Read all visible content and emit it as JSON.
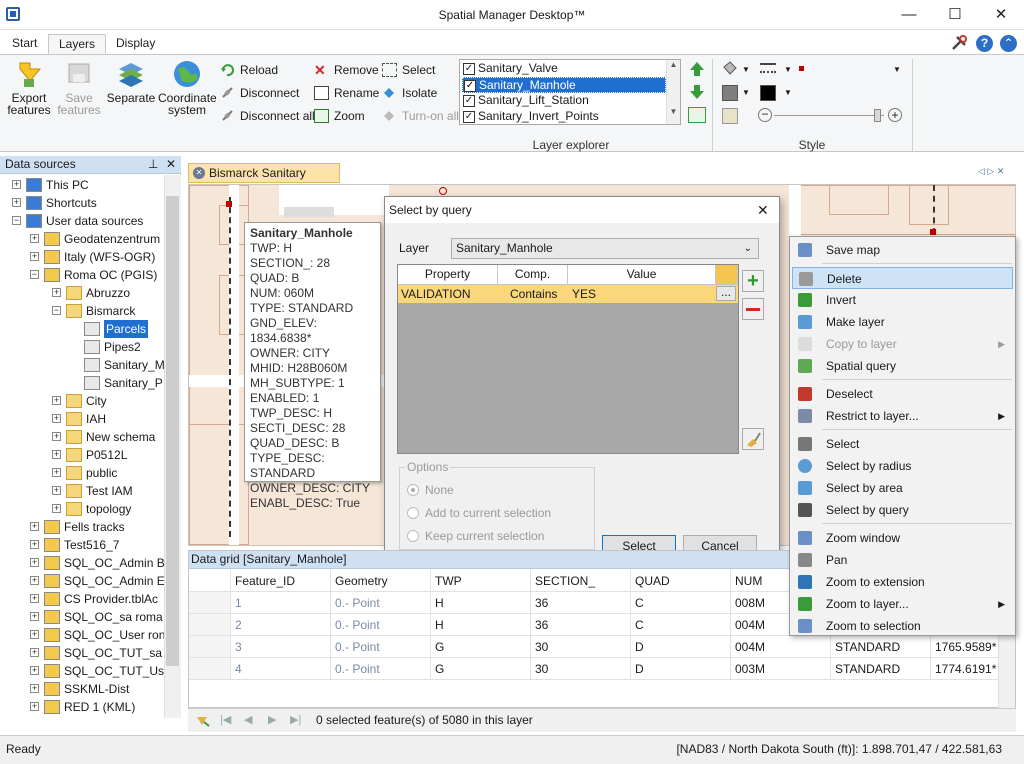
{
  "app": {
    "title": "Spatial Manager Desktop™"
  },
  "window_controls": {
    "minimize": "—",
    "maximize": "☐",
    "close": "✕"
  },
  "ribbon_tabs": [
    {
      "label": "Start"
    },
    {
      "label": "Layers"
    },
    {
      "label": "Display"
    }
  ],
  "ribbon": {
    "export_features": "Export\nfeatures",
    "save_features": "Save\nfeatures",
    "separate": "Separate",
    "coordinate_system": "Coordinate\nsystem",
    "reload": "Reload",
    "disconnect": "Disconnect",
    "disconnect_all": "Disconnect all",
    "remove": "Remove",
    "rename": "Rename",
    "zoom": "Zoom",
    "select": "Select",
    "isolate": "Isolate",
    "turn_on_all": "Turn-on all",
    "layer_explorer_label": "Layer explorer",
    "style_label": "Style",
    "layers": [
      {
        "label": "Sanitary_Valve",
        "checked": true,
        "selected": false
      },
      {
        "label": "Sanitary_Manhole",
        "checked": true,
        "selected": true
      },
      {
        "label": "Sanitary_Lift_Station",
        "checked": true,
        "selected": false
      },
      {
        "label": "Sanitary_Invert_Points",
        "checked": true,
        "selected": false
      }
    ],
    "colors": {
      "fill": "#7f7f7f",
      "stroke": "#000000",
      "accent": "#c00000"
    }
  },
  "datasources": {
    "title": "Data sources",
    "items": [
      {
        "label": "This PC",
        "level": 0,
        "exp": "+"
      },
      {
        "label": "Shortcuts",
        "level": 0,
        "exp": "+"
      },
      {
        "label": "User data sources",
        "level": 0,
        "exp": "−"
      },
      {
        "label": "Geodatenzentrum",
        "level": 1,
        "exp": "+"
      },
      {
        "label": "Italy (WFS-OGR)",
        "level": 1,
        "exp": "+"
      },
      {
        "label": "Roma OC (PGIS)",
        "level": 1,
        "exp": "−"
      },
      {
        "label": "Abruzzo",
        "level": 2,
        "exp": "+"
      },
      {
        "label": "Bismarck",
        "level": 2,
        "exp": "−"
      },
      {
        "label": "Parcels",
        "level": 3,
        "exp": "",
        "selected": true
      },
      {
        "label": "Pipes2",
        "level": 3,
        "exp": ""
      },
      {
        "label": "Sanitary_M",
        "level": 3,
        "exp": ""
      },
      {
        "label": "Sanitary_P",
        "level": 3,
        "exp": ""
      },
      {
        "label": "City",
        "level": 2,
        "exp": "+"
      },
      {
        "label": "IAH",
        "level": 2,
        "exp": "+"
      },
      {
        "label": "New schema",
        "level": 2,
        "exp": "+"
      },
      {
        "label": "P0512L",
        "level": 2,
        "exp": "+"
      },
      {
        "label": "public",
        "level": 2,
        "exp": "+"
      },
      {
        "label": "Test IAM",
        "level": 2,
        "exp": "+"
      },
      {
        "label": "topology",
        "level": 2,
        "exp": "+"
      },
      {
        "label": "Fells tracks",
        "level": 1,
        "exp": "+"
      },
      {
        "label": "Test516_7",
        "level": 1,
        "exp": "+"
      },
      {
        "label": "SQL_OC_Admin B",
        "level": 1,
        "exp": "+"
      },
      {
        "label": "SQL_OC_Admin E",
        "level": 1,
        "exp": "+"
      },
      {
        "label": "CS Provider.tblAc",
        "level": 1,
        "exp": "+"
      },
      {
        "label": "SQL_OC_sa roma",
        "level": 1,
        "exp": "+"
      },
      {
        "label": "SQL_OC_User ron",
        "level": 1,
        "exp": "+"
      },
      {
        "label": "SQL_OC_TUT_sa r",
        "level": 1,
        "exp": "+"
      },
      {
        "label": "SQL_OC_TUT_Use",
        "level": 1,
        "exp": "+"
      },
      {
        "label": "SSKML-Dist",
        "level": 1,
        "exp": "+"
      },
      {
        "label": "RED 1 (KML)",
        "level": 1,
        "exp": "+"
      }
    ]
  },
  "doc_tab": {
    "label": "Bismarck Sanitary sewer *"
  },
  "infobox": {
    "title": "Sanitary_Manhole",
    "lines": [
      "TWP: H",
      "SECTION_: 28",
      "QUAD: B",
      "NUM: 060M",
      "TYPE: STANDARD",
      "GND_ELEV: 1834.6838*",
      "OWNER: CITY",
      "MHID: H28B060M",
      "MH_SUBTYPE: 1",
      "ENABLED: 1",
      "TWP_DESC: H",
      "SECTI_DESC: 28",
      "QUAD_DESC: B",
      "TYPE_DESC: STANDARD",
      "OWNER_DESC: CITY",
      "ENABL_DESC: True"
    ]
  },
  "dialog": {
    "title": "Select by query",
    "layer_label": "Layer",
    "layer_value": "Sanitary_Manhole",
    "col_property": "Property",
    "col_comp": "Comp.",
    "col_value": "Value",
    "row": {
      "property": "VALIDATION",
      "comp": "Contains",
      "value": "YES",
      "browse": "..."
    },
    "options_label": "Options",
    "opt_none": "None",
    "opt_add": "Add to current selection",
    "opt_keep": "Keep current selection",
    "select_btn": "Select",
    "cancel_btn": "Cancel"
  },
  "datagrid": {
    "title": "Data grid [Sanitary_Manhole]",
    "columns": [
      "Feature_ID",
      "Geometry",
      "TWP",
      "SECTION_",
      "QUAD",
      "NUM"
    ],
    "rows": [
      {
        "Feature_ID": "1",
        "Geometry": "0.- Point",
        "TWP": "H",
        "SECTION_": "36",
        "QUAD": "C",
        "NUM": "008M",
        "TYPE": "",
        "GND": ""
      },
      {
        "Feature_ID": "2",
        "Geometry": "0.- Point",
        "TWP": "H",
        "SECTION_": "36",
        "QUAD": "C",
        "NUM": "004M",
        "TYPE": "",
        "GND": ""
      },
      {
        "Feature_ID": "3",
        "Geometry": "0.- Point",
        "TWP": "G",
        "SECTION_": "30",
        "QUAD": "D",
        "NUM": "004M",
        "TYPE": "STANDARD",
        "GND": "1765.9589*"
      },
      {
        "Feature_ID": "4",
        "Geometry": "0.- Point",
        "TWP": "G",
        "SECTION_": "30",
        "QUAD": "D",
        "NUM": "003M",
        "TYPE": "STANDARD",
        "GND": "1774.6191*"
      }
    ],
    "status": "0 selected feature(s) of 5080 in this layer"
  },
  "statusbar": {
    "left": "Ready",
    "right": "[NAD83 / North Dakota South (ft)]: 1.898.701,47 / 422.581,63"
  },
  "context_menu": {
    "items": [
      {
        "label": "Save map",
        "icon": "save-map-icon",
        "highlighted": false,
        "disabled": false,
        "submenu": false
      },
      {
        "label": "Delete",
        "icon": "eraser-icon",
        "highlighted": true,
        "disabled": false,
        "submenu": false
      },
      {
        "label": "Invert",
        "icon": "invert-icon",
        "highlighted": false,
        "disabled": false,
        "submenu": false
      },
      {
        "label": "Make layer",
        "icon": "make-layer-icon",
        "highlighted": false,
        "disabled": false,
        "submenu": false
      },
      {
        "label": "Copy to layer",
        "icon": "copy-to-layer-icon",
        "highlighted": false,
        "disabled": true,
        "submenu": true
      },
      {
        "label": "Spatial query",
        "icon": "spatial-query-icon",
        "highlighted": false,
        "disabled": false,
        "submenu": false
      },
      {
        "label": "Deselect",
        "icon": "deselect-icon",
        "highlighted": false,
        "disabled": false,
        "submenu": false
      },
      {
        "label": "Restrict to layer...",
        "icon": "restrict-icon",
        "highlighted": false,
        "disabled": false,
        "submenu": true
      },
      {
        "label": "Select",
        "icon": "pointer-icon",
        "highlighted": false,
        "disabled": false,
        "submenu": false
      },
      {
        "label": "Select by radius",
        "icon": "circle-icon",
        "highlighted": false,
        "disabled": false,
        "submenu": false
      },
      {
        "label": "Select by area",
        "icon": "polygon-icon",
        "highlighted": false,
        "disabled": false,
        "submenu": false
      },
      {
        "label": "Select by query",
        "icon": "binoculars-icon",
        "highlighted": false,
        "disabled": false,
        "submenu": false
      },
      {
        "label": "Zoom window",
        "icon": "zoom-window-icon",
        "highlighted": false,
        "disabled": false,
        "submenu": false
      },
      {
        "label": "Pan",
        "icon": "pan-icon",
        "highlighted": false,
        "disabled": false,
        "submenu": false
      },
      {
        "label": "Zoom to extension",
        "icon": "zoom-extent-icon",
        "highlighted": false,
        "disabled": false,
        "submenu": false
      },
      {
        "label": "Zoom to layer...",
        "icon": "zoom-layer-icon",
        "highlighted": false,
        "disabled": false,
        "submenu": true
      },
      {
        "label": "Zoom to selection",
        "icon": "zoom-selection-icon",
        "highlighted": false,
        "disabled": false,
        "submenu": false
      }
    ]
  }
}
